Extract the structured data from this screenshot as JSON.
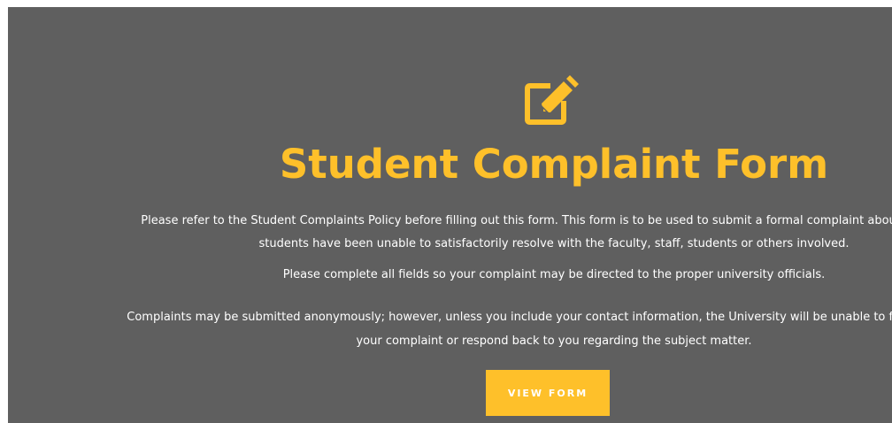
{
  "colors": {
    "panel_background": "#5f5f5f",
    "accent": "#fec02a",
    "text": "#ffffff"
  },
  "header": {
    "icon": "edit-icon",
    "title": "Student Complaint Form"
  },
  "intro": {
    "paragraph1_line1": "Please refer to the Student Complaints Policy before filling out this form. This form is to be used to submit a formal complaint about issues that",
    "paragraph1_line2": "students have been unable to satisfactorily resolve with the faculty, staff, students or others involved.",
    "paragraph2": "Please complete all fields so your complaint may be directed to the proper university officials.",
    "paragraph3_line1": "Complaints may be submitted anonymously; however, unless you include your contact information, the University will be unable to fully investigate",
    "paragraph3_line2": "your complaint or respond back to you regarding the subject matter."
  },
  "actions": {
    "view_form_label": "VIEW FORM"
  }
}
